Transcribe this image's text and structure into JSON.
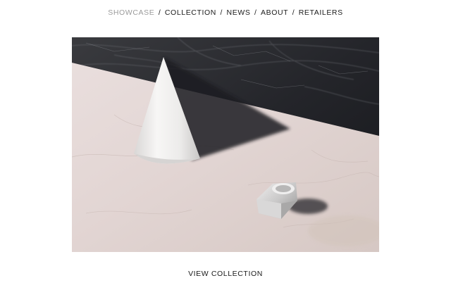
{
  "nav": {
    "items": [
      {
        "label": "SHOWCASE",
        "active": true
      },
      {
        "label": "COLLECTION",
        "active": false
      },
      {
        "label": "NEWS",
        "active": false
      },
      {
        "label": "ABOUT",
        "active": false
      },
      {
        "label": "RETAILERS",
        "active": false
      }
    ],
    "separator": "/"
  },
  "cta": {
    "label": "VIEW COLLECTION"
  },
  "colors": {
    "active_nav": "#9a9a9a",
    "text": "#1a1a1a",
    "background": "#ffffff"
  }
}
